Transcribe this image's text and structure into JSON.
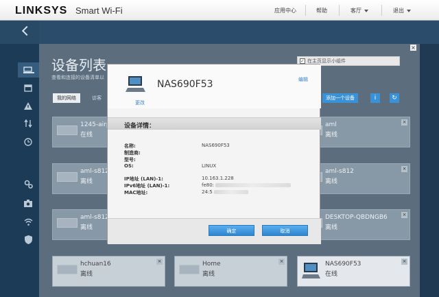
{
  "header": {
    "brand": "LINKSYS",
    "product": "Smart Wi-Fi",
    "menu": [
      "应用中心",
      "帮助",
      "客厅",
      "退出"
    ]
  },
  "page": {
    "title": "设备列表",
    "desc": "查看和连接的设备清单以",
    "widget_label": "在主页显示小组件",
    "tabs": [
      "我的网络",
      "访客"
    ],
    "add_button": "添加一个设备"
  },
  "devices": [
    {
      "name": "1245-airpu",
      "status": "在线"
    },
    {
      "name": "aml",
      "status": "离线"
    },
    {
      "name": "aml-s812",
      "status": "离线"
    },
    {
      "name": "aml-s812",
      "status": "离线"
    },
    {
      "name": "aml-s812",
      "status": "离线"
    },
    {
      "name": "DESKTOP-QBDNGB6",
      "status": "离线"
    },
    {
      "name": "hchuan16",
      "status": "离线"
    },
    {
      "name": "Home",
      "status": "离线"
    },
    {
      "name": "NAS690F53",
      "status": "在线"
    }
  ],
  "modal": {
    "device_name": "NAS690F53",
    "change": "更改",
    "edit": "编辑",
    "section": "设备详情：",
    "rows": [
      {
        "label": "名称:",
        "value": "NAS690F53"
      },
      {
        "label": "制造商:",
        "value": ""
      },
      {
        "label": "型号:",
        "value": ""
      },
      {
        "label": "OS:",
        "value": "LINUX"
      },
      {
        "label": "IP地址 (LAN)-1:",
        "value": "10.163.1.228"
      },
      {
        "label": "IPv6地址 (LAN)-1:",
        "value": "fe80:"
      },
      {
        "label": "MAC地址:",
        "value": "24:5"
      }
    ],
    "ok": "确定",
    "cancel": "取消"
  },
  "colors": {
    "accent": "#3a91d6",
    "sidebar": "#1b3b57"
  }
}
